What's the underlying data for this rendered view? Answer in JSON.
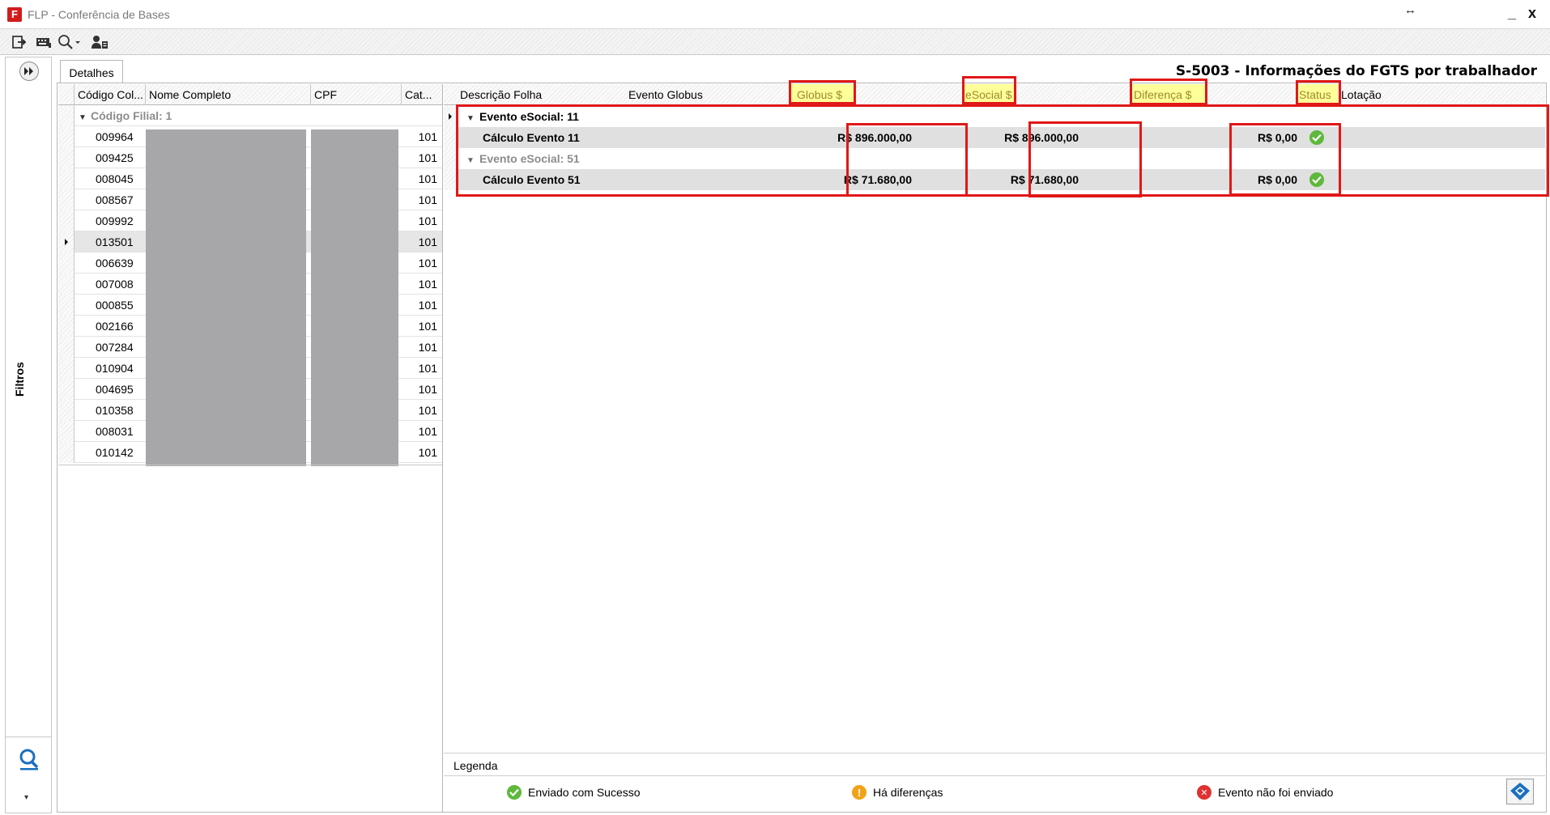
{
  "window": {
    "logo_glyph": "F",
    "title": "FLP - Conferência de Bases",
    "resize_glyph": "↔",
    "minimize_glyph": "_",
    "close_glyph": "x"
  },
  "toolbar": {
    "icons": [
      "exit-icon",
      "keyboard-icon",
      "search-dropdown-icon",
      "user-icon"
    ]
  },
  "filters": {
    "label": "Filtros",
    "expand_icon": "double-chevron-right-icon",
    "dropdown_glyph": "▾"
  },
  "tabs": [
    {
      "label": "Detalhes"
    }
  ],
  "header_title": "S-5003 - Informações do FGTS por trabalhador",
  "left_grid": {
    "columns": [
      "Código Col...",
      "Nome Completo",
      "CPF",
      "Cat..."
    ],
    "group_label": "Código Filial: 1",
    "rows": [
      {
        "code": "009964",
        "cat": "101"
      },
      {
        "code": "009425",
        "cat": "101"
      },
      {
        "code": "008045",
        "cat": "101"
      },
      {
        "code": "008567",
        "cat": "101"
      },
      {
        "code": "009992",
        "cat": "101"
      },
      {
        "code": "013501",
        "cat": "101",
        "selected": true
      },
      {
        "code": "006639",
        "cat": "101"
      },
      {
        "code": "007008",
        "cat": "101"
      },
      {
        "code": "000855",
        "cat": "101"
      },
      {
        "code": "002166",
        "cat": "101"
      },
      {
        "code": "007284",
        "cat": "101"
      },
      {
        "code": "010904",
        "cat": "101"
      },
      {
        "code": "004695",
        "cat": "101"
      },
      {
        "code": "010358",
        "cat": "101"
      },
      {
        "code": "008031",
        "cat": "101"
      },
      {
        "code": "010142",
        "cat": "101"
      }
    ]
  },
  "right_grid": {
    "columns": [
      "Descrição Folha",
      "Evento Globus",
      "Globus $",
      "eSocial $",
      "Diferença $",
      "Status",
      "Lotação"
    ],
    "groups": [
      {
        "label": "Evento eSocial: 11",
        "row": {
          "descricao": "Cálculo Evento 11",
          "globus": "R$ 896.000,00",
          "esocial": "R$ 896.000,00",
          "diferenca": "R$ 0,00",
          "status": "ok"
        }
      },
      {
        "label": "Evento eSocial: 51",
        "row": {
          "descricao": "Cálculo Evento 51",
          "globus": "R$ 71.680,00",
          "esocial": "R$ 71.680,00",
          "diferenca": "R$ 0,00",
          "status": "ok"
        }
      }
    ]
  },
  "legend": {
    "title": "Legenda",
    "items": [
      {
        "label": "Enviado com Sucesso",
        "icon": "check-circle-icon",
        "color": "#5db83b"
      },
      {
        "label": "Há diferenças",
        "icon": "warning-circle-icon",
        "color": "#f0a318",
        "glyph": "!"
      },
      {
        "label": "Evento não foi enviado",
        "icon": "error-circle-icon",
        "color": "#e03131",
        "glyph": "✕"
      }
    ]
  },
  "colors": {
    "highlight_red": "#e01818",
    "column_highlight_yellow": "#ffff99",
    "redaction_gray": "#a7a7a9"
  }
}
